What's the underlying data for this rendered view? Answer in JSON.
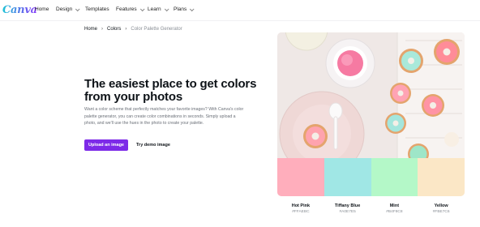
{
  "nav": {
    "logo": "Canva",
    "items": [
      {
        "label": "Home",
        "dropdown": false
      },
      {
        "label": "Design",
        "dropdown": true
      },
      {
        "label": "Templates",
        "dropdown": false
      },
      {
        "label": "Features",
        "dropdown": true
      },
      {
        "label": "Learn",
        "dropdown": true
      },
      {
        "label": "Plans",
        "dropdown": true
      }
    ]
  },
  "breadcrumb": {
    "items": [
      "Home",
      "Colors"
    ],
    "current": "Color Palette Generator",
    "separator": "›"
  },
  "hero": {
    "headline": "The easiest place to get colors from your photos",
    "description": "Want a color scheme that perfectly matches your favorite images? With Canva's color palette generator, you can create color combinations in seconds. Simply upload a photo, and we'll use the hues in the photo to create your palette.",
    "primary_button": "Upload an image",
    "secondary_button": "Try demo image"
  },
  "palette": [
    {
      "name": "Hot Pink",
      "hex": "#FFAEBC"
    },
    {
      "name": "Tiffany Blue",
      "hex": "#A0E7E5"
    },
    {
      "name": "Mint",
      "hex": "#B4F8C8"
    },
    {
      "name": "Yellow",
      "hex": "#FBE7C6"
    }
  ],
  "colors": {
    "brand_purple": "#7d2ae8",
    "photo_background": "#f3ecea"
  }
}
